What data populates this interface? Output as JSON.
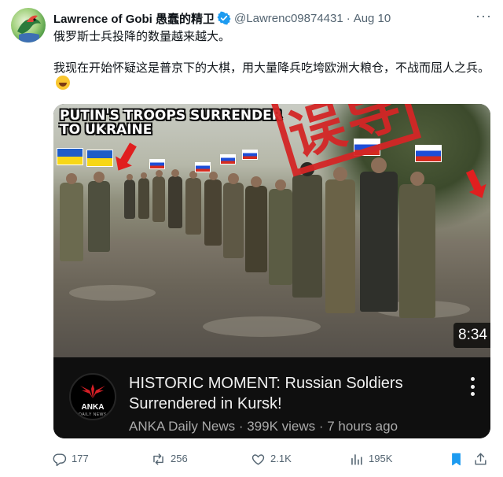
{
  "tweet": {
    "display_name": "Lawrence of Gobi 愚蠢的精卫",
    "handle": "@Lawrenc09874431",
    "separator": "·",
    "date": "Aug 10",
    "more_label": "···",
    "text_line1": "俄罗斯士兵投降的数量越来越大。",
    "text_line2": "我现在开始怀疑这是普京下的大棋，用大量降兵吃垮欧洲大粮仓，不战而屈人之兵。"
  },
  "video": {
    "overlay_title_line1": "PUTIN'S TROOPS SURRENDER",
    "overlay_title_line2": "TO UKRAINE",
    "stamp_text": "误导",
    "duration": "8:34",
    "title": "HISTORIC MOMENT: Russian Soldiers Surrendered in Kursk!",
    "channel_logo_text": "ANKA",
    "channel_logo_subtext": "DAILY NEWS",
    "meta": "ANKA Daily News · 399K views · 7 hours ago"
  },
  "actions": {
    "replies": "177",
    "reposts": "256",
    "likes": "2.1K",
    "views": "195K"
  },
  "colors": {
    "text_primary": "#0f1419",
    "text_secondary": "#536471",
    "verified_blue": "#1d9bf0",
    "bookmark_blue": "#1d9bf0",
    "stamp_red": "#d42626",
    "card_background": "#0f0f0f"
  },
  "icons": {
    "verified": "verified-badge-icon",
    "reply": "reply-icon",
    "repost": "repost-icon",
    "like": "heart-icon",
    "views": "analytics-icon",
    "bookmark": "bookmark-icon",
    "share": "share-icon",
    "more": "more-icon"
  }
}
